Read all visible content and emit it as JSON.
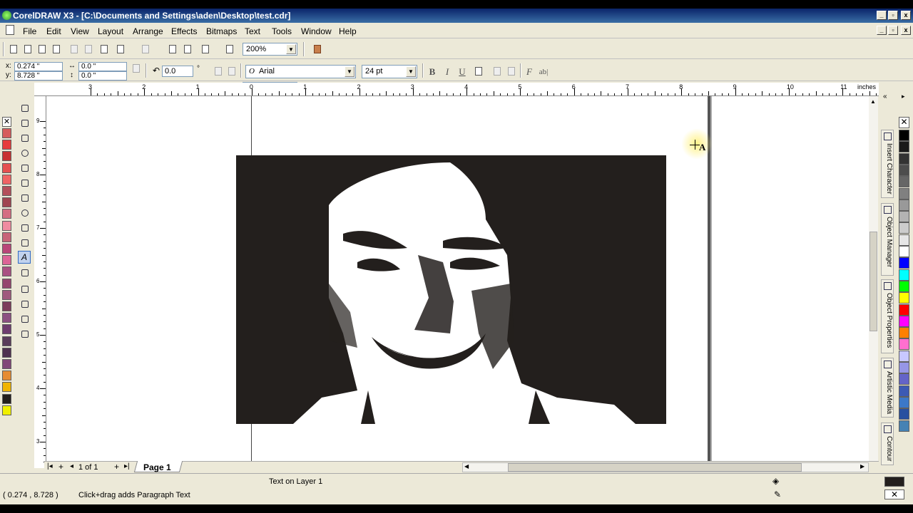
{
  "window": {
    "title": "CorelDRAW X3 - [C:\\Documents and Settings\\aden\\Desktop\\test.cdr]"
  },
  "menu": [
    "File",
    "Edit",
    "View",
    "Layout",
    "Arrange",
    "Effects",
    "Bitmaps",
    "Text",
    "Tools",
    "Window",
    "Help"
  ],
  "toolbar": {
    "zoom": "200%"
  },
  "property_bar": {
    "x_label": "x:",
    "x_value": "0.274 \"",
    "y_label": "y:",
    "y_value": "8.728 \"",
    "w_value": "0.0 \"",
    "h_value": "0.0 \"",
    "angle_value": "0.0",
    "angle_unit": "°",
    "font_name": "Arial",
    "font_size": "24 pt",
    "font_icon": "O",
    "bold": "B",
    "italic": "I",
    "underline": "U",
    "char_fmt": "F",
    "edit_text": "ab|"
  },
  "rulers": {
    "units": "inches",
    "h_labels": [
      "3",
      "2",
      "1",
      "0",
      "1",
      "2",
      "3",
      "4",
      "5",
      "6",
      "7",
      "8",
      "9",
      "10",
      "11"
    ],
    "v_labels": [
      "9",
      "8",
      "7",
      "6",
      "5",
      "4",
      "3"
    ]
  },
  "page_nav": {
    "page_count": "1 of 1",
    "page_tab": "Page 1"
  },
  "status": {
    "coords": "( 0.274 , 8.728 )",
    "hint": "Click+drag adds Paragraph Text",
    "layer": "Text on Layer 1"
  },
  "cursor": {
    "glyph": "A"
  },
  "dockers": [
    "Insert Character",
    "Object Manager",
    "Object Properties",
    "Artistic Media",
    "Contour"
  ],
  "colors": {
    "left_palette": [
      "#d65c5c",
      "#e63c3c",
      "#c83232",
      "#e65050",
      "#f06464",
      "#b4505a",
      "#a04650",
      "#d46e82",
      "#f08ca0",
      "#c86478",
      "#ba4678",
      "#dc6496",
      "#aa5082",
      "#96466e",
      "#a05a7d",
      "#7d3c5a",
      "#8c5082",
      "#6e3c6e",
      "#5a3c5a",
      "#503250",
      "#824678",
      "#e68c32",
      "#f0b400",
      "#231f1d",
      "#f0f000"
    ],
    "right_palette": [
      "#000000",
      "#1a1a1a",
      "#333333",
      "#4d4d4d",
      "#666666",
      "#808080",
      "#999999",
      "#b3b3b3",
      "#cccccc",
      "#e6e6e6",
      "#ffffff",
      "#0000ff",
      "#00ffff",
      "#00ff00",
      "#ffff00",
      "#ff0000",
      "#ff00ff",
      "#ff8000",
      "#ff6fcf",
      "#c8c8ff",
      "#9696e6",
      "#6464c8",
      "#3c5ab4",
      "#3c78c8",
      "#2850a0",
      "#4682b4"
    ],
    "fill_indicator": "#231f1d"
  }
}
